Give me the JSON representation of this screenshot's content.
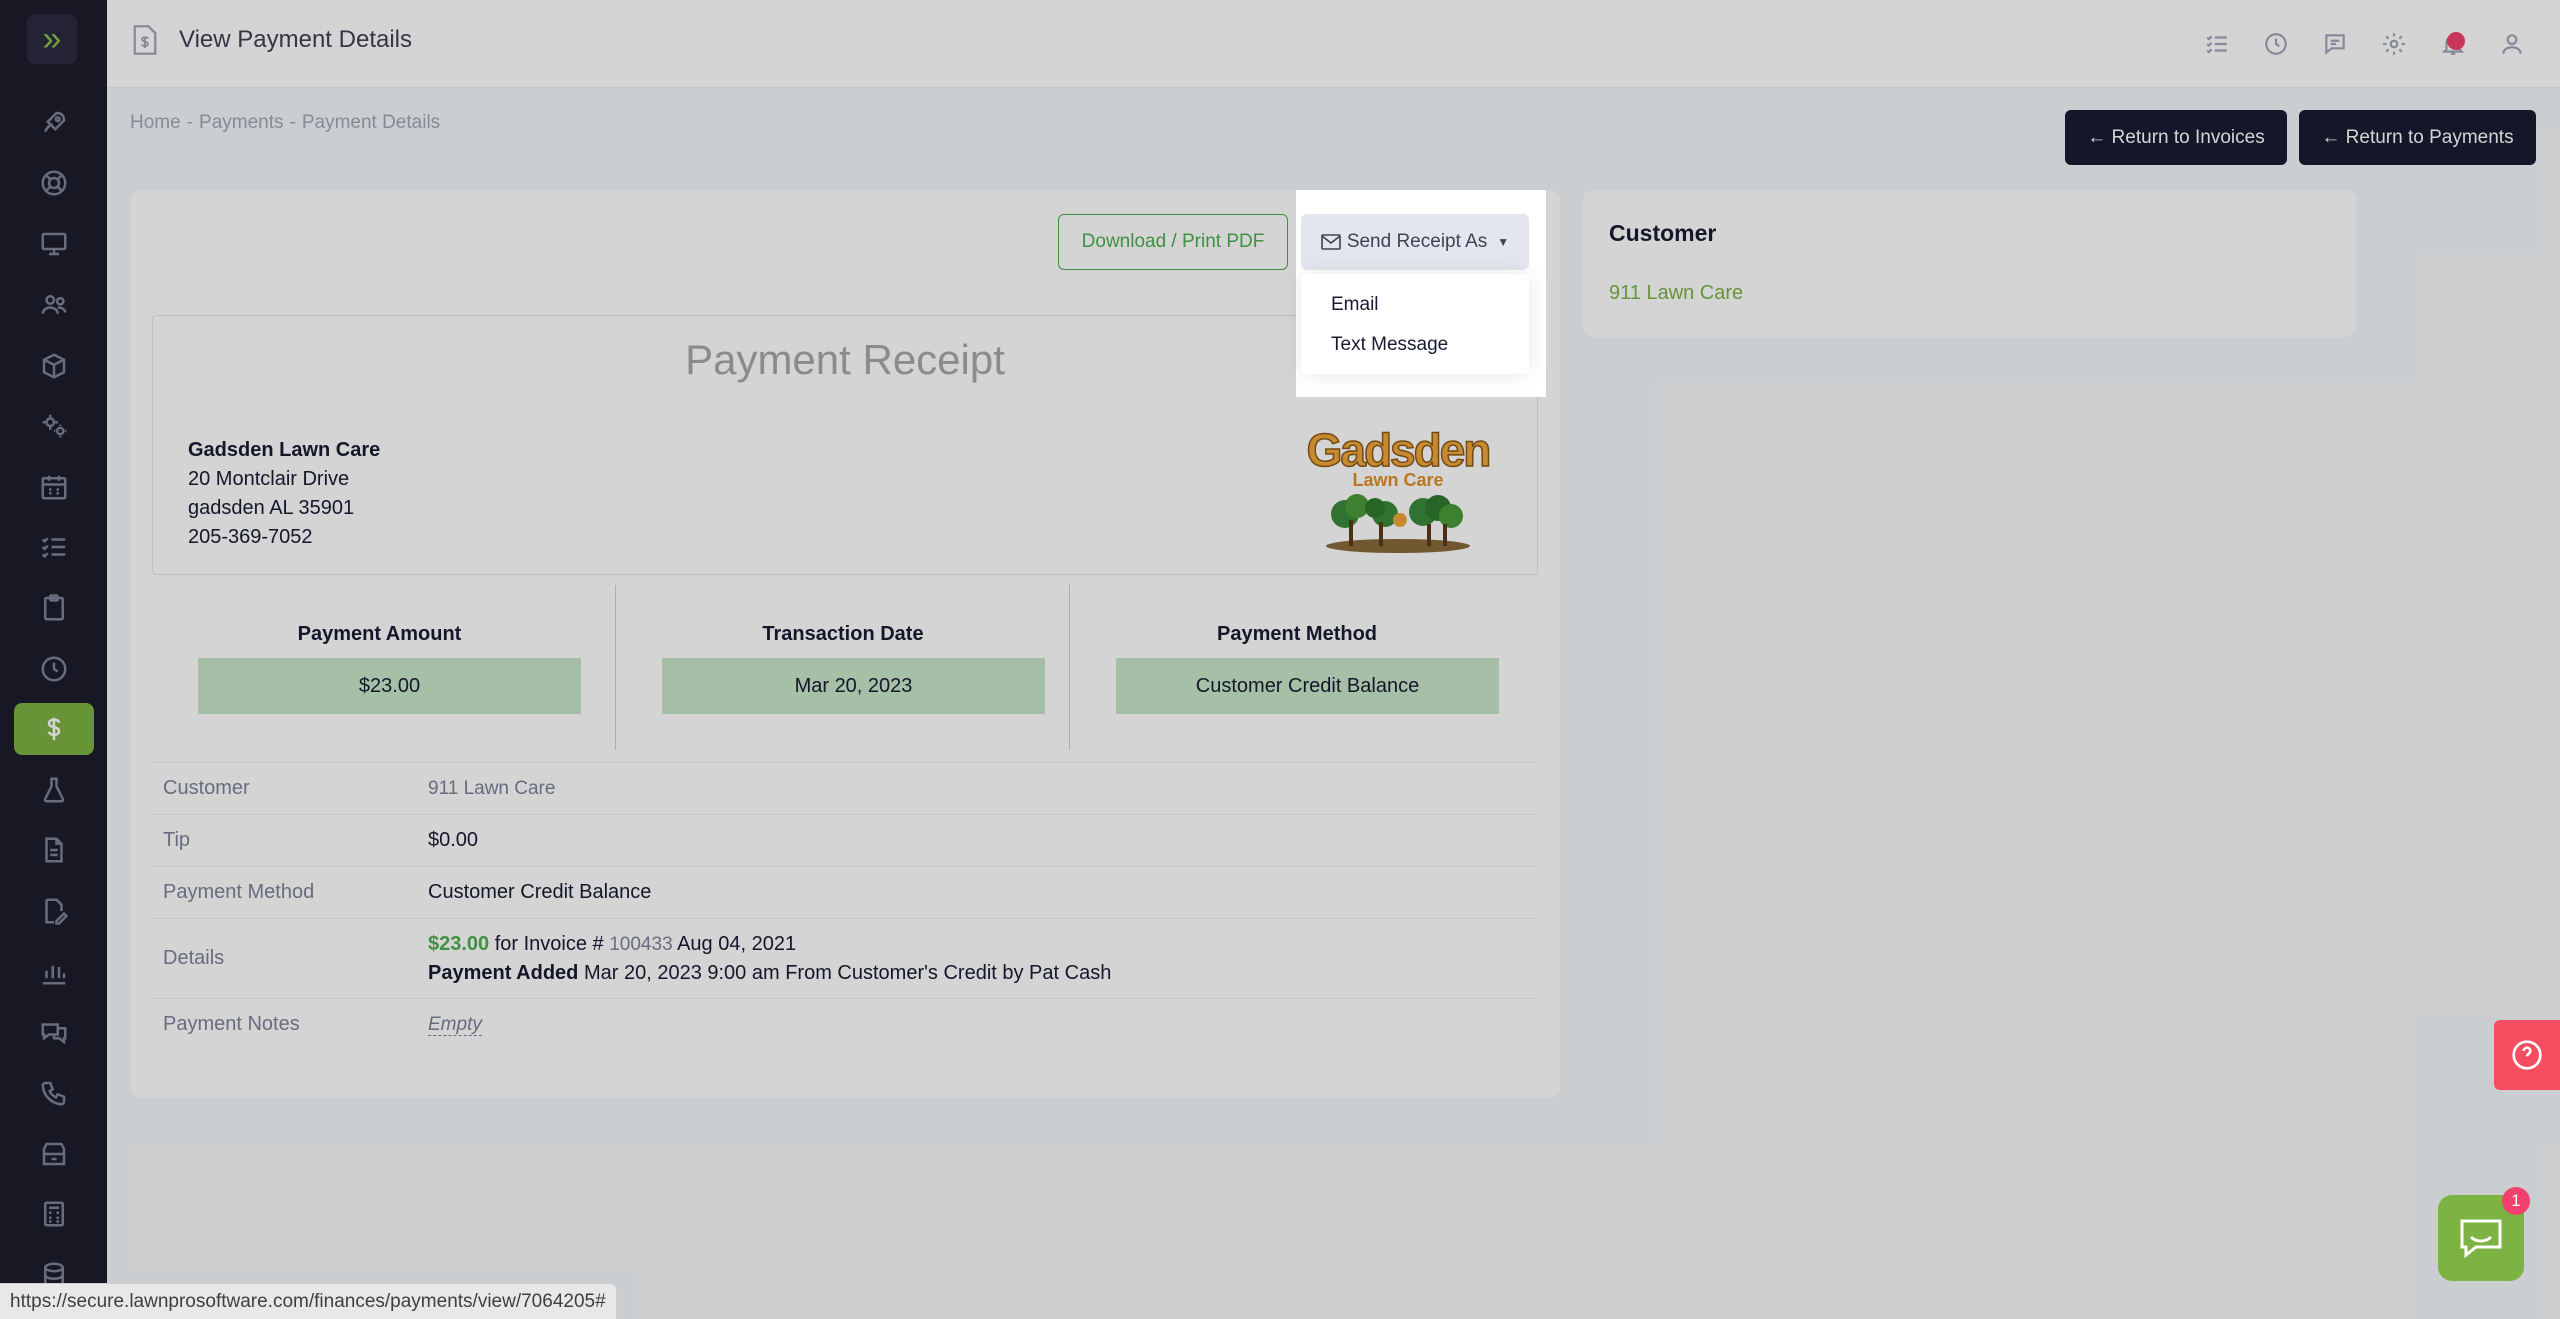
{
  "header": {
    "title": "View Payment Details"
  },
  "breadcrumb": {
    "items": [
      "Home",
      "-",
      "Payments",
      "-",
      "Payment Details"
    ]
  },
  "toolbar": {
    "return_invoices": "← Return to Invoices",
    "return_payments": "← Return to Payments"
  },
  "actions": {
    "download_pdf": "Download / Print PDF",
    "send_receipt": "Send Receipt As",
    "menu": [
      "Email",
      "Text Message"
    ]
  },
  "receipt": {
    "title": "Payment Receipt",
    "company_name": "Gadsden Lawn Care",
    "address_line1": "20 Montclair Drive",
    "address_line2": "gadsden AL 35901",
    "phone": "205-369-7052",
    "logo_text_main": "Gadsden",
    "logo_text_sub": "Lawn Care"
  },
  "stats": {
    "amount_label": "Payment Amount",
    "amount_value": "$23.00",
    "date_label": "Transaction Date",
    "date_value": "Mar 20, 2023",
    "method_label": "Payment Method",
    "method_value": "Customer Credit Balance"
  },
  "details": {
    "customer_label": "Customer",
    "customer_value": "911 Lawn Care",
    "tip_label": "Tip",
    "tip_value": "$0.00",
    "method_label": "Payment Method",
    "method_value": "Customer Credit Balance",
    "details_label": "Details",
    "details_amount": "$23.00",
    "details_for": " for Invoice # ",
    "details_invoice": "100433",
    "details_date": " Aug 04, 2021",
    "details_added_label": "Payment Added",
    "details_added_text": " Mar 20, 2023 9:00 am From Customer's Credit by Pat Cash",
    "notes_label": "Payment Notes",
    "notes_value": "Empty"
  },
  "customer_card": {
    "title": "Customer",
    "name": "911 Lawn Care"
  },
  "chat": {
    "badge": "1"
  },
  "status_url": "https://secure.lawnprosoftware.com/finances/payments/view/7064205#",
  "colors": {
    "accent": "#7cb342",
    "sidebar": "#1e1e2d",
    "stat_fill": "#c8e6c9",
    "danger": "#f64e60"
  }
}
